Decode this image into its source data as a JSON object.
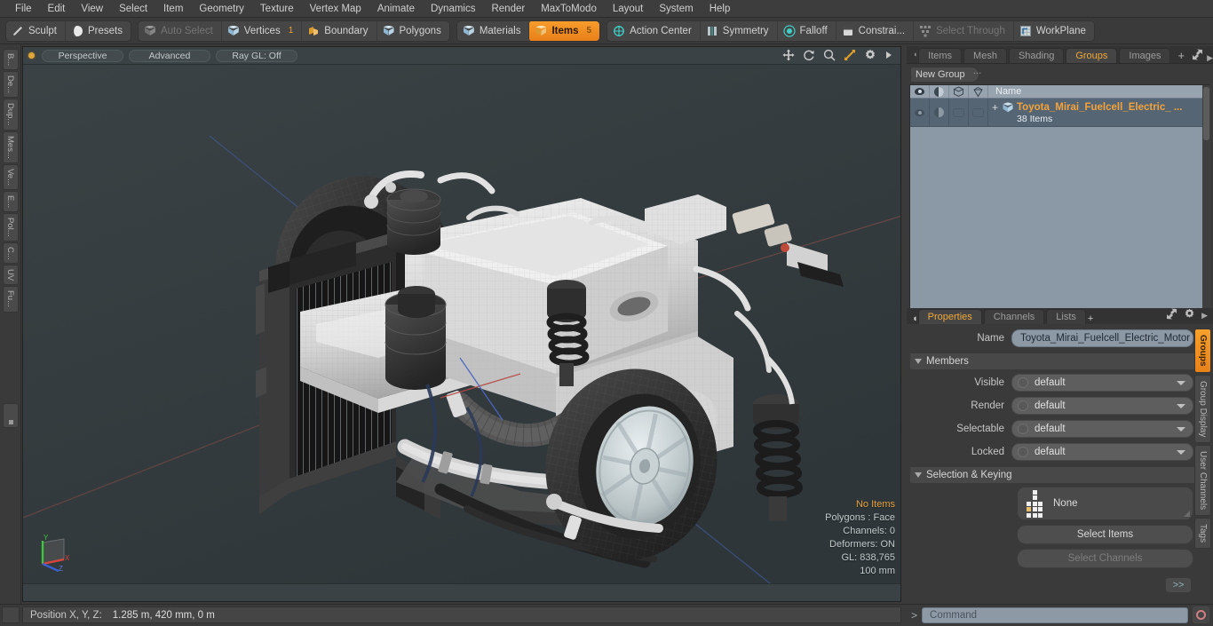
{
  "menu": {
    "items": [
      "File",
      "Edit",
      "View",
      "Select",
      "Item",
      "Geometry",
      "Texture",
      "Vertex Map",
      "Animate",
      "Dynamics",
      "Render",
      "MaxToModo",
      "Layout",
      "System",
      "Help"
    ]
  },
  "toolbar": {
    "groups": [
      {
        "buttons": [
          {
            "label": "Sculpt",
            "icon": "pencil-icon",
            "state": "normal"
          },
          {
            "label": "Presets",
            "icon": "sphere-icon",
            "state": "normal"
          }
        ]
      },
      {
        "buttons": [
          {
            "label": "Auto Select",
            "icon": "cube-gray-icon",
            "state": "dim"
          },
          {
            "label": "Vertices",
            "icon": "cube-icon",
            "state": "normal",
            "badge": "1"
          },
          {
            "label": "Boundary",
            "icon": "boundary-icon",
            "state": "normal"
          },
          {
            "label": "Polygons",
            "icon": "cube-icon",
            "state": "normal"
          }
        ]
      },
      {
        "buttons": [
          {
            "label": "Materials",
            "icon": "cube-icon",
            "state": "normal"
          },
          {
            "label": "Items",
            "icon": "cube-orange-icon",
            "state": "active",
            "badge": "5"
          }
        ]
      },
      {
        "buttons": [
          {
            "label": "Action Center",
            "icon": "crosshair-icon",
            "state": "normal"
          },
          {
            "label": "Symmetry",
            "icon": "symmetry-icon",
            "state": "normal"
          },
          {
            "label": "Falloff",
            "icon": "falloff-icon",
            "state": "normal"
          },
          {
            "label": "Constrai...",
            "icon": "constraint-icon",
            "state": "normal"
          },
          {
            "label": "Select Through",
            "icon": "select-through-icon",
            "state": "dim"
          },
          {
            "label": "WorkPlane",
            "icon": "workplane-icon",
            "state": "normal"
          }
        ]
      }
    ]
  },
  "left_tabs": [
    "B...",
    "De...",
    "Dup...",
    "Mes...",
    "Ve...",
    "E...",
    "Pol...",
    "C...",
    "UV",
    "Fu..."
  ],
  "viewport": {
    "pills": [
      "Perspective",
      "Advanced",
      "Ray GL: Off"
    ],
    "icons": [
      "move-icon",
      "rotate-icon",
      "zoom-icon",
      "fit-icon",
      "gear-icon",
      "play-icon"
    ],
    "stats": {
      "items": "No Items",
      "polygons": "Polygons : Face",
      "channels": "Channels: 0",
      "deformers": "Deformers: ON",
      "gl": "GL: 838,765",
      "scale": "100 mm"
    },
    "gizmo": {
      "x": "X",
      "y": "Y",
      "z": "Z"
    }
  },
  "right_panel": {
    "tabs": [
      {
        "label": "Items",
        "active": false
      },
      {
        "label": "Mesh ...",
        "active": false
      },
      {
        "label": "Shading",
        "active": false
      },
      {
        "label": "Groups",
        "active": true
      },
      {
        "label": "Images",
        "active": false
      }
    ],
    "add_tab": "+",
    "new_group_button": "New Group",
    "list": {
      "columns": [
        "eye-icon",
        "shading-icon",
        "wireframe-icon",
        "render-icon",
        "Name"
      ],
      "name_header": "Name",
      "rows": [
        {
          "expand": "+",
          "name": "Toyota_Mirai_Fuelcell_Electric_ ...",
          "subtitle": "38 Items"
        }
      ]
    }
  },
  "properties": {
    "tabs": [
      {
        "label": "Properties",
        "active": true
      },
      {
        "label": "Channels",
        "active": false
      },
      {
        "label": "Lists",
        "active": false
      }
    ],
    "add_tab": "+",
    "name_label": "Name",
    "name_value": "Toyota_Mirai_Fuelcell_Electric_Motor (",
    "members_section": "Members",
    "rows": [
      {
        "label": "Visible",
        "value": "default"
      },
      {
        "label": "Render",
        "value": "default"
      },
      {
        "label": "Selectable",
        "value": "default"
      },
      {
        "label": "Locked",
        "value": "default"
      }
    ],
    "selection_section": "Selection & Keying",
    "key_value": "None",
    "select_items_button": "Select Items",
    "select_channels_button": "Select Channels",
    "go_button": ">>"
  },
  "right_tabs": [
    {
      "label": "Groups",
      "active": true
    },
    {
      "label": "Group Display",
      "active": false
    },
    {
      "label": "User Channels",
      "active": false
    },
    {
      "label": "Tags",
      "active": false
    }
  ],
  "statusbar": {
    "position_label": "Position X, Y, Z:",
    "position_value": "1.285 m, 420 mm, 0 m",
    "command_prompt": ">",
    "command_placeholder": "Command"
  },
  "colors": {
    "accent": "#f0a83a",
    "viewport_bg": "#333b3e",
    "panel_bg": "#3a3a3a",
    "list_bg": "#8b99a6",
    "axis_x": "#c0504d",
    "axis_y": "#4a9a4a",
    "axis_z": "#4060c0"
  }
}
